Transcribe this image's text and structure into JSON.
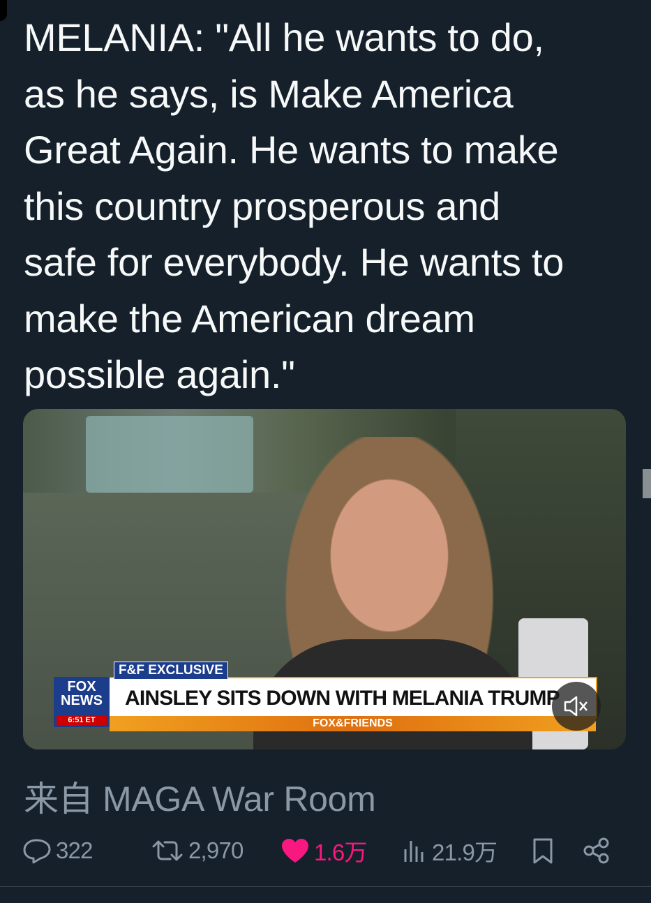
{
  "tweet": {
    "text": "MELANIA: \"All he wants to do,\nas he says, is Make America\nGreat Again. He wants to make\nthis country prosperous and\nsafe for everybody. He wants to\nmake the American dream\npossible again.\""
  },
  "media": {
    "tag": "F&F EXCLUSIVE",
    "logo_line1": "FOX",
    "logo_line2": "NEWS",
    "time": "6:51 ET",
    "headline": "AINSLEY SITS DOWN WITH MELANIA TRUMP",
    "strip": "FOX&FRIENDS",
    "sound_icon": "speaker-muted-icon"
  },
  "source": {
    "label": "来自 MAGA War Room"
  },
  "actions": {
    "replies": "322",
    "retweets": "2,970",
    "likes": "1.6万",
    "views": "21.9万"
  },
  "colors": {
    "background": "#15202b",
    "muted": "#8b98a5",
    "like": "#f91880"
  }
}
